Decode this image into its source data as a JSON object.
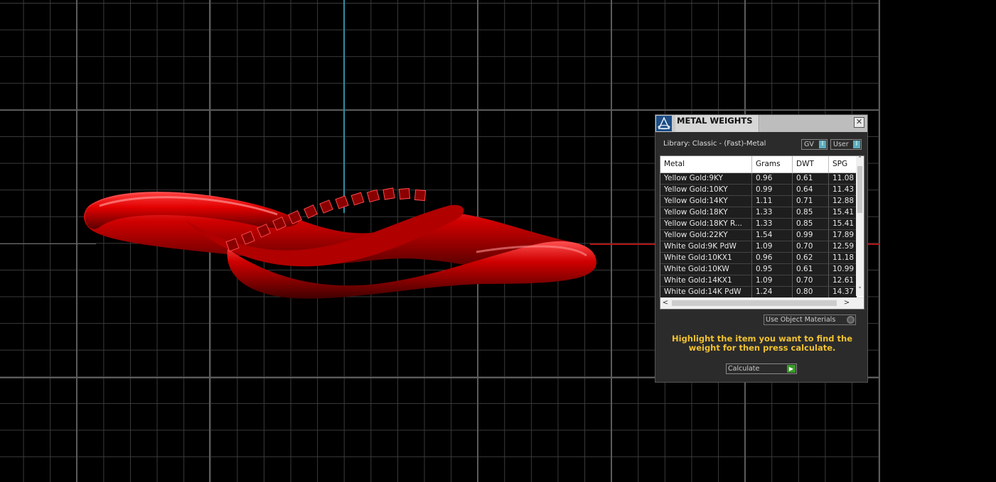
{
  "dialog": {
    "title": "METAL WEIGHTS",
    "close_icon": "close-icon",
    "logo_icon": "app-logo-icon",
    "library_label": "Library: Classic - (Fast)-Metal",
    "toggles": {
      "gv_label": "GV",
      "user_label": "User",
      "indicator_glyph": "I"
    },
    "table": {
      "headers": {
        "metal": "Metal",
        "grams": "Grams",
        "dwt": "DWT",
        "spg": "SPG"
      },
      "rows": [
        {
          "metal": "Yellow Gold:9KY",
          "grams": "0.96",
          "dwt": "0.61",
          "spg": "11.08"
        },
        {
          "metal": "Yellow Gold:10KY",
          "grams": "0.99",
          "dwt": "0.64",
          "spg": "11.43"
        },
        {
          "metal": "Yellow Gold:14KY",
          "grams": "1.11",
          "dwt": "0.71",
          "spg": "12.88"
        },
        {
          "metal": "Yellow Gold:18KY",
          "grams": "1.33",
          "dwt": "0.85",
          "spg": "15.41"
        },
        {
          "metal": "Yellow Gold:18KY R...",
          "grams": "1.33",
          "dwt": "0.85",
          "spg": "15.41"
        },
        {
          "metal": "Yellow Gold:22KY",
          "grams": "1.54",
          "dwt": "0.99",
          "spg": "17.89"
        },
        {
          "metal": "White Gold:9K PdW",
          "grams": "1.09",
          "dwt": "0.70",
          "spg": "12.59"
        },
        {
          "metal": "White Gold:10KX1",
          "grams": "0.96",
          "dwt": "0.62",
          "spg": "11.18"
        },
        {
          "metal": "White Gold:10KW",
          "grams": "0.95",
          "dwt": "0.61",
          "spg": "10.99"
        },
        {
          "metal": "White Gold:14KX1",
          "grams": "1.09",
          "dwt": "0.70",
          "spg": "12.61"
        },
        {
          "metal": "White Gold:14K PdW",
          "grams": "1.24",
          "dwt": "0.80",
          "spg": "14.37"
        }
      ]
    },
    "use_object_materials_label": "Use Object Materials",
    "instruction": "Highlight the item you want to find the weight for then press calculate.",
    "calculate_label": "Calculate",
    "scroll_glyphs": {
      "up": "˄",
      "down": "˅",
      "left": "<",
      "right": ">"
    },
    "calc_glyph": "▶",
    "close_glyph": "✕"
  },
  "viewport": {
    "ring_color": "#d40000",
    "y_axis_color": "#2f8ea3",
    "x_axis_color": "#b21515"
  }
}
